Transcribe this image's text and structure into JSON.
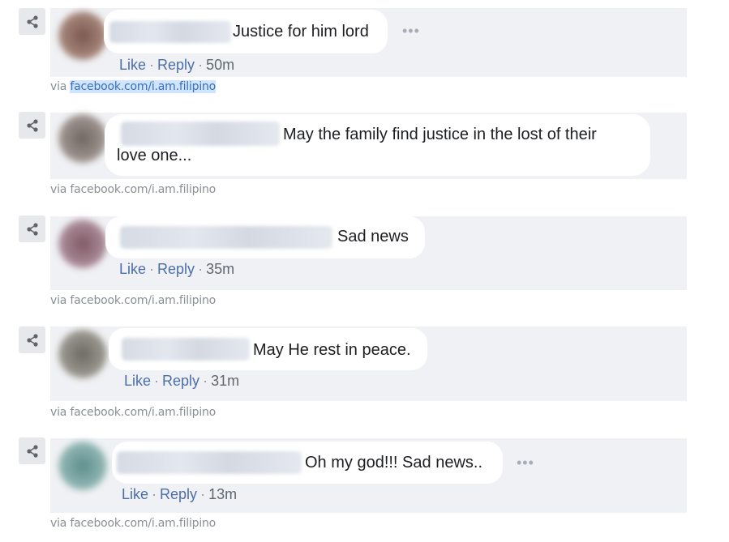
{
  "comments": [
    {
      "text": "Justice for him lord",
      "actions": {
        "like": "Like",
        "reply": "Reply",
        "time": "50m"
      },
      "via_prefix": "via",
      "via_link": "facebook.com/i.am.filipino"
    },
    {
      "text_line1": "May the family find justice in the lost of their",
      "text_line2": "love one...",
      "via_prefix": "via",
      "via_link": "facebook.com/i.am.filipino"
    },
    {
      "text": "Sad news",
      "actions": {
        "like": "Like",
        "reply": "Reply",
        "time": "35m"
      },
      "via_prefix": "via",
      "via_link": "facebook.com/i.am.filipino"
    },
    {
      "text": "May He rest in peace.",
      "actions": {
        "like": "Like",
        "reply": "Reply",
        "time": "31m"
      },
      "via_prefix": "via",
      "via_link": "facebook.com/i.am.filipino"
    },
    {
      "text": "Oh my god!!! Sad news..",
      "actions": {
        "like": "Like",
        "reply": "Reply",
        "time": "13m"
      },
      "via_prefix": "via",
      "via_link": "facebook.com/i.am.filipino"
    }
  ],
  "icons": {
    "share": "share-icon",
    "more": "more-options-icon"
  },
  "colors": {
    "card_bg": "#f0f1f4",
    "link": "#4b6fa8",
    "selection": "#cfe4ff"
  }
}
